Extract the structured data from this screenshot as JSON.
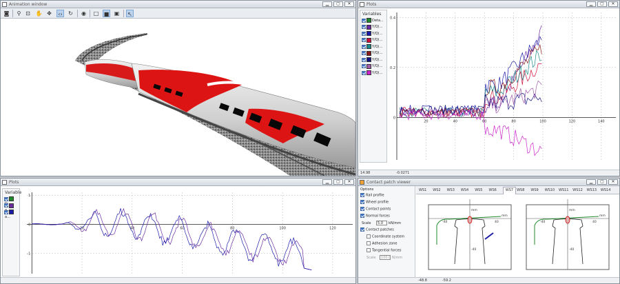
{
  "anim": {
    "title": "Animation window",
    "tools": [
      "camera-icon",
      "zoom-icon",
      "zoom-fit-icon",
      "hand-icon",
      "move-icon",
      "code-view-icon",
      "rotate-icon",
      "eye-icon",
      "box-icon",
      "box-solid-icon",
      "box-textured-icon",
      "pointer-icon"
    ]
  },
  "plot_tr": {
    "title": "Plots",
    "variables_header": "Variables",
    "variables": [
      {
        "label": "Deta...",
        "color": "#1f8a2a"
      },
      {
        "label": "Y/Q(...",
        "color": "#6b2aa0"
      },
      {
        "label": "Y/Q(...",
        "color": "#1a1aa8"
      },
      {
        "label": "Y/Q(...",
        "color": "#d0103a"
      },
      {
        "label": "Y/Q(...",
        "color": "#1d8a8a"
      },
      {
        "label": "Y/Q(...",
        "color": "#8a1a1a"
      },
      {
        "label": "Y/Q(...",
        "color": "#121280"
      },
      {
        "label": "Y/Q(...",
        "color": "#a05aa8"
      },
      {
        "label": "Y/Q(...",
        "color": "#cc22cc"
      }
    ],
    "status_left": "14.98",
    "status_right": "-0.0271"
  },
  "plot_bl": {
    "title": "Plots",
    "variables_header": "Variables",
    "variables": [
      {
        "label": "D...",
        "color": "#1f8a2a"
      },
      {
        "label": "a...",
        "color": "#6b2aa0"
      },
      {
        "label": "a...",
        "color": "#1a1aa8"
      }
    ]
  },
  "cpv": {
    "title": "Contact patch viewer",
    "options_header": "Options",
    "options": [
      {
        "label": "Rail profile",
        "checked": true,
        "indent": false
      },
      {
        "label": "Wheel profile",
        "checked": true,
        "indent": false
      },
      {
        "label": "Contact points",
        "checked": true,
        "indent": false
      },
      {
        "label": "Normal forces",
        "checked": true,
        "indent": false
      }
    ],
    "scale_label": "Scale",
    "scale_value": "5.0",
    "scale_unit": "kN/mm",
    "patches_label": "Contact patches",
    "sub_options": [
      "Coordinate system",
      "Adhesion zone",
      "Tangential forces"
    ],
    "scale2_label": "Scale",
    "scale2_value": "100.0",
    "scale2_unit": "N/mm",
    "ws_tabs": [
      "WS1",
      "WS2",
      "WS3",
      "WS4",
      "WS5",
      "WS6",
      "WS7",
      "WS8",
      "WS9",
      "WS10",
      "WS11",
      "WS12",
      "WS13",
      "WS14"
    ],
    "active_tab": "WS7",
    "axis_unit": "mm",
    "status_left": "-48.8",
    "status_right": "-59.2"
  },
  "chart_data": [
    {
      "type": "line",
      "x_ticks": [
        "20",
        "40",
        "60",
        "80",
        "100",
        "120",
        "140"
      ],
      "y_ticks": [
        "0.4",
        "0.2",
        "0"
      ],
      "xlim": [
        0,
        150
      ],
      "ylim": [
        -0.17,
        0.42
      ],
      "grid": true,
      "series_colors": [
        "#1f8a2a",
        "#6b2aa0",
        "#1a1aa8",
        "#d0103a",
        "#1d8a8a",
        "#8a1a1a",
        "#121280",
        "#a05aa8",
        "#cc22cc"
      ]
    },
    {
      "type": "line",
      "x_ticks": [
        "20",
        "40",
        "60",
        "80",
        "100",
        "120"
      ],
      "y_ticks": [
        "1",
        "0",
        "-1"
      ],
      "xlim": [
        -2,
        128
      ],
      "ylim": [
        -1.7,
        1.1
      ],
      "grid": true,
      "series_colors": [
        "#1f8a2a",
        "#6b2aa0",
        "#1a1aa8"
      ]
    }
  ],
  "profile_ticks": {
    "left_neg": "-40",
    "left_pos": "40",
    "bottom": "-40"
  }
}
